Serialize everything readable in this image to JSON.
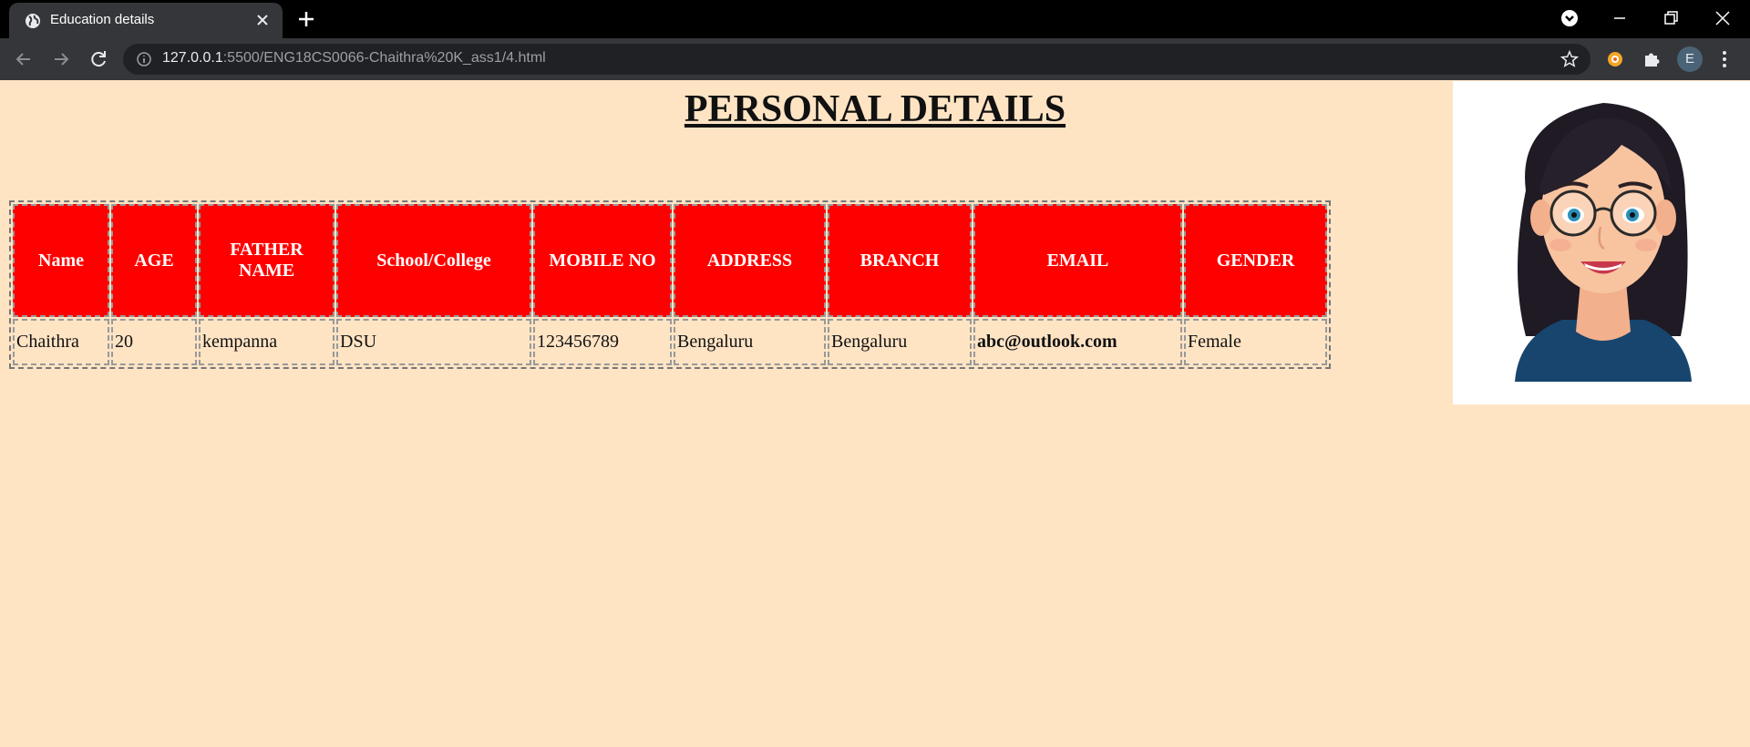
{
  "browser": {
    "tab_title": "Education details",
    "url_host": "127.0.0.1",
    "url_rest": ":5500/ENG18CS0066-Chaithra%20K_ass1/4.html",
    "profile_initial": "E"
  },
  "page": {
    "title": "PERSONAL DETAILS",
    "columns": [
      "Name",
      "AGE",
      "FATHER NAME",
      "School/College",
      "MOBILE NO",
      "ADDRESS",
      "BRANCH",
      "EMAIL",
      "GENDER"
    ],
    "row": [
      "Chaithra",
      "20",
      "kempanna",
      "DSU",
      "123456789",
      "Bengaluru",
      "Bengaluru",
      "abc@outlook.com",
      "Female"
    ]
  },
  "colors": {
    "page_bg": "#ffe4c4",
    "header_bg": "#ff0000"
  },
  "icons": [
    "globe-icon",
    "close-icon",
    "plus-icon",
    "back-icon",
    "forward-icon",
    "reload-icon",
    "info-icon",
    "star-icon",
    "extension-icon",
    "puzzle-icon",
    "menu-icon"
  ]
}
